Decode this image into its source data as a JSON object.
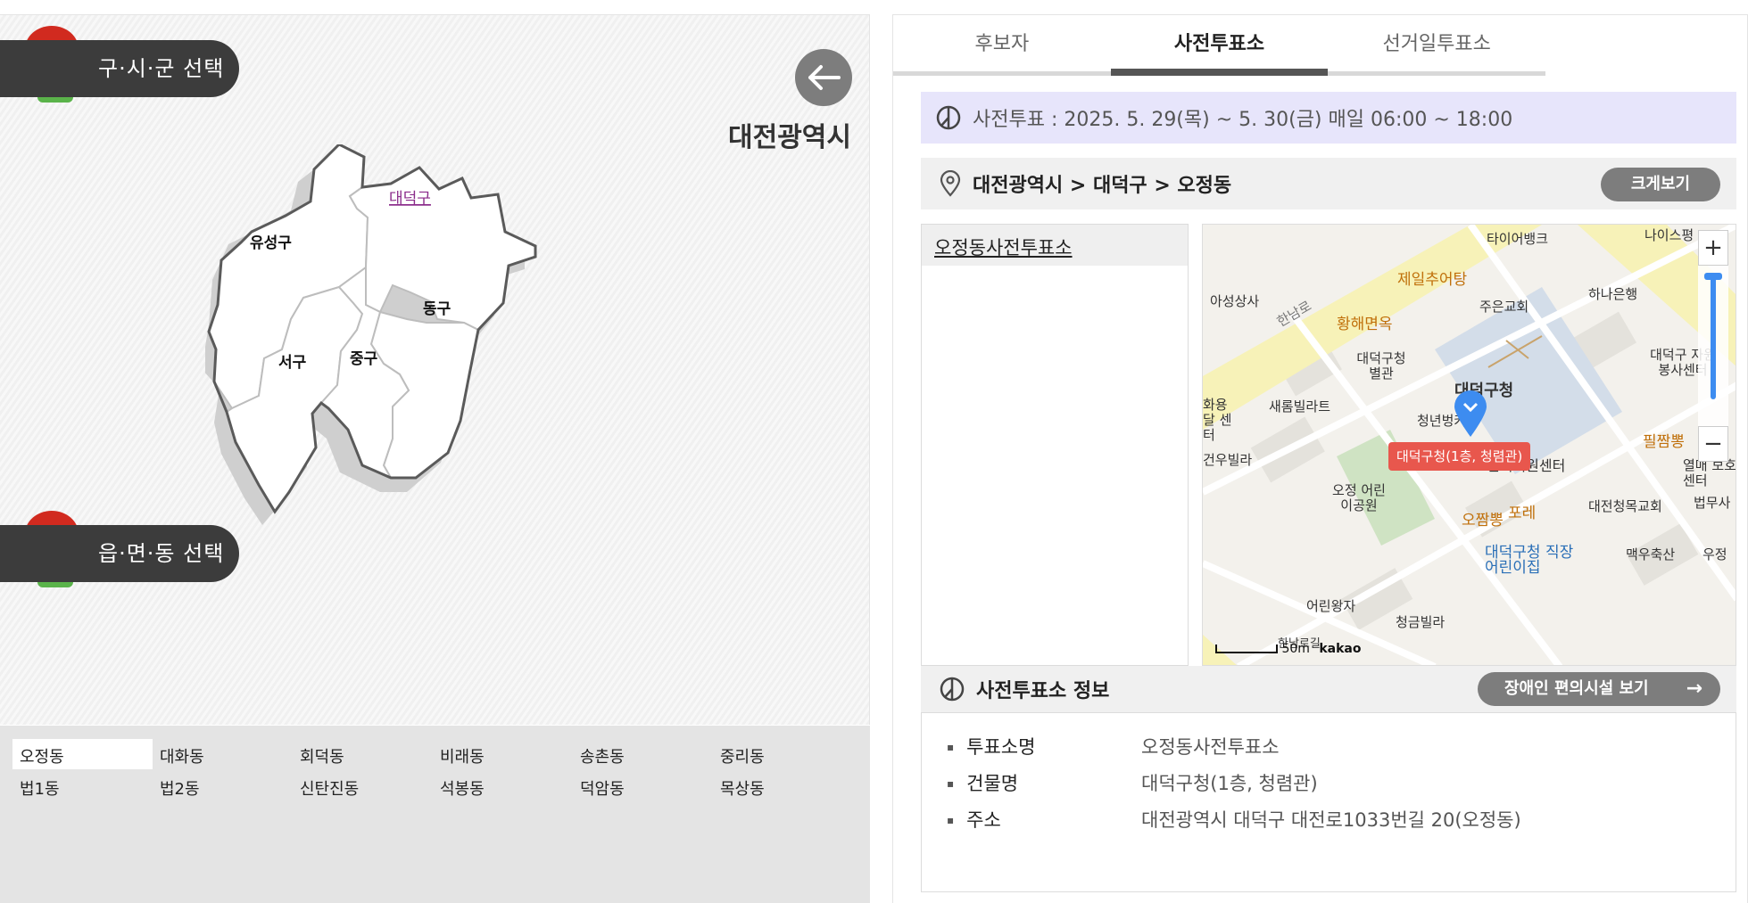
{
  "left": {
    "sigungu_label": "구·시·군 선택",
    "emd_label": "읍·면·동 선택",
    "city": "대전광역시",
    "districts": [
      {
        "name": "유성구"
      },
      {
        "name": "대덕구",
        "selected": true
      },
      {
        "name": "동구"
      },
      {
        "name": "서구"
      },
      {
        "name": "중구"
      }
    ],
    "dongs": [
      "오정동",
      "대화동",
      "회덕동",
      "비래동",
      "송촌동",
      "중리동",
      "법1동",
      "법2동",
      "신탄진동",
      "석봉동",
      "덕암동",
      "목상동"
    ],
    "active_dong": "오정동"
  },
  "tabs": [
    "후보자",
    "사전투표소",
    "선거일투표소"
  ],
  "active_tab": "사전투표소",
  "period": "사전투표 : 2025. 5. 29(목) ~ 5. 30(금) 매일 06:00 ~ 18:00",
  "location": "대전광역시 > 대덕구 > 오정동",
  "enlarge_label": "크게보기",
  "place_list": [
    "오정동사전투표소"
  ],
  "map": {
    "marker_label": "대덕구청(1층, 청렴관)",
    "pois": [
      "타이어뱅크",
      "나이스평",
      "제일추어탕",
      "아성상사",
      "하나은행",
      "주은교회",
      "한남로",
      "황해면옥",
      "대덕구청 별관",
      "대덕구청",
      "대덕구 자원봉사센터",
      "청년벙커",
      "새롬빌라트",
      "화용달 센터",
      "필짬뽕",
      "건우빌라",
      "선거지원센터",
      "열매 보호센터",
      "오정 어린이공원",
      "오짬뽕",
      "포레",
      "대전청목교회",
      "법무사",
      "맥우축산",
      "우정",
      "대덕구청 직장어린이집",
      "어린왕자",
      "청금빌라",
      "한남로길"
    ],
    "zoom_in": "+",
    "zoom_out": "−",
    "scale": "50m",
    "attribution": "kakao"
  },
  "info": {
    "title": "사전투표소 정보",
    "accessible_label": "장애인 편의시설 보기",
    "rows": [
      {
        "k": "투표소명",
        "v": "오정동사전투표소"
      },
      {
        "k": "건물명",
        "v": "대덕구청(1층, 청렴관)"
      },
      {
        "k": "주소",
        "v": "대전광역시 대덕구 대전로1033번길 20(오정동)"
      }
    ]
  },
  "colors": {
    "accent_tab": "#555555",
    "period_bg": "#e7e5fb",
    "marker": "#e8574d",
    "button": "#7d7d7d"
  }
}
